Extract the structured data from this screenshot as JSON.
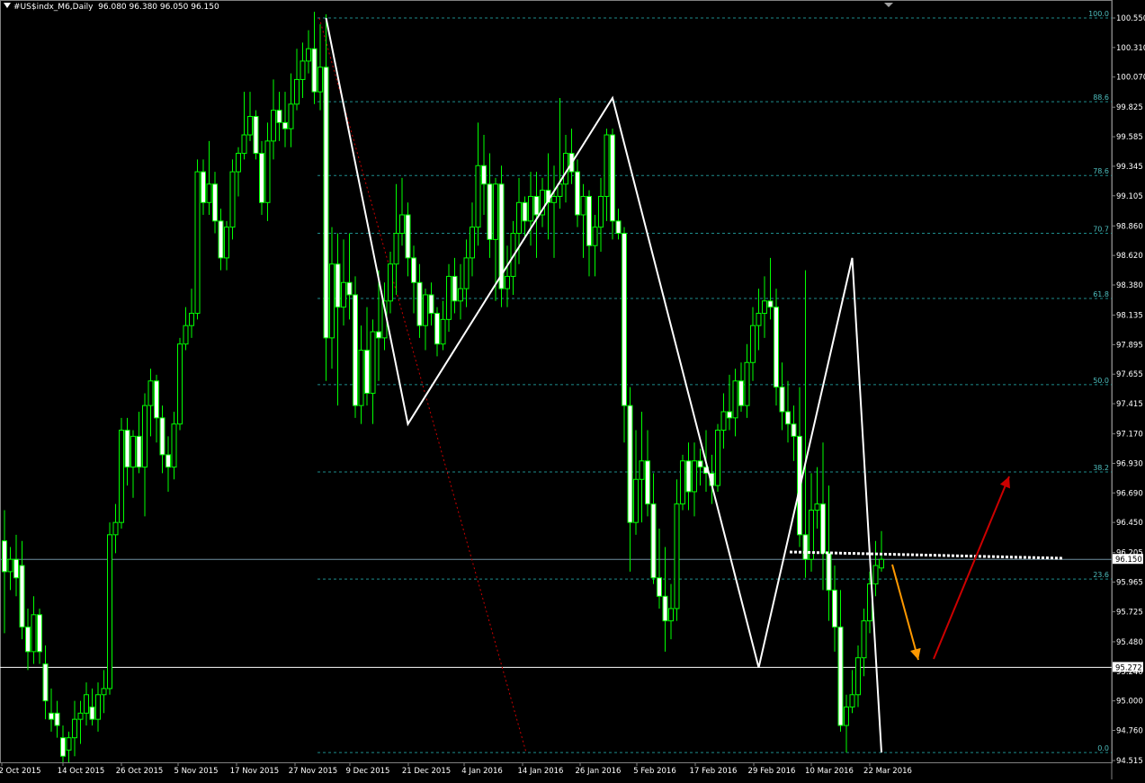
{
  "header": {
    "symbol_title": "#US$indx_M6,Daily",
    "ohlc": "96.080 96.380 96.050 96.150"
  },
  "colors": {
    "background": "#000000",
    "candle": "#00ff00",
    "fib_line": "#1e8c8c",
    "fib_text": "#4fbfbf",
    "zigzag": "#ffffff",
    "axis_text": "#ffffff",
    "trend_dotted": "#cc0000",
    "arrow_down": "#ff9900",
    "arrow_up": "#cc0000",
    "price_line": "#6f8fa0"
  },
  "chart_data": {
    "type": "candlestick",
    "title": "#US$indx_M6,Daily",
    "y_range": [
      94.515,
      100.66
    ],
    "y_tick_labels": [
      "100.550",
      "100.310",
      "100.070",
      "99.825",
      "99.585",
      "99.345",
      "99.105",
      "98.860",
      "98.620",
      "98.380",
      "98.135",
      "97.895",
      "97.655",
      "97.415",
      "97.170",
      "96.930",
      "96.690",
      "96.450",
      "96.205",
      "95.965",
      "95.725",
      "95.480",
      "95.240",
      "95.000",
      "94.760",
      "94.515"
    ],
    "x_tick_labels": [
      "2 Oct 2015",
      "14 Oct 2015",
      "26 Oct 2015",
      "5 Nov 2015",
      "17 Nov 2015",
      "27 Nov 2015",
      "9 Dec 2015",
      "21 Dec 2015",
      "4 Jan 2016",
      "14 Jan 2016",
      "26 Jan 2016",
      "5 Feb 2016",
      "17 Feb 2016",
      "29 Feb 2016",
      "10 Mar 2016",
      "22 Mar 2016"
    ],
    "current_price": "96.150",
    "horizontal_level": "95.272",
    "fibonacci_levels": [
      {
        "label": "100.0",
        "price": 100.55
      },
      {
        "label": "88.6",
        "price": 99.87
      },
      {
        "label": "78.6",
        "price": 99.27
      },
      {
        "label": "70.7",
        "price": 98.8
      },
      {
        "label": "61.8",
        "price": 98.27
      },
      {
        "label": "50.0",
        "price": 97.57
      },
      {
        "label": "38.2",
        "price": 96.86
      },
      {
        "label": "23.6",
        "price": 95.99
      },
      {
        "label": "0.0",
        "price": 94.58
      }
    ],
    "zigzag": [
      {
        "date": "27 Nov 2015",
        "price": 100.55
      },
      {
        "date": "9 Dec 2015",
        "price": 97.25
      },
      {
        "date": "14 Jan 2016",
        "price": 99.9
      },
      {
        "date": "5 Feb 2016",
        "price": 95.27
      },
      {
        "date": "29 Feb 2016",
        "price": 98.6
      },
      {
        "date": "14 Mar 2016",
        "price": 94.58
      }
    ],
    "candles": [
      {
        "o": 96.3,
        "h": 96.55,
        "l": 95.55,
        "c": 96.05
      },
      {
        "o": 96.05,
        "h": 96.25,
        "l": 95.9,
        "c": 96.15
      },
      {
        "o": 96.15,
        "h": 96.35,
        "l": 95.85,
        "c": 96.0
      },
      {
        "o": 96.1,
        "h": 96.3,
        "l": 95.5,
        "c": 95.6
      },
      {
        "o": 95.6,
        "h": 95.75,
        "l": 95.25,
        "c": 95.4
      },
      {
        "o": 95.4,
        "h": 95.85,
        "l": 95.3,
        "c": 95.7
      },
      {
        "o": 95.7,
        "h": 95.75,
        "l": 95.3,
        "c": 95.4
      },
      {
        "o": 95.3,
        "h": 95.45,
        "l": 94.85,
        "c": 95.0
      },
      {
        "o": 94.9,
        "h": 95.1,
        "l": 94.75,
        "c": 94.85
      },
      {
        "o": 94.9,
        "h": 95.0,
        "l": 94.7,
        "c": 94.8
      },
      {
        "o": 94.7,
        "h": 94.8,
        "l": 94.5,
        "c": 94.55
      },
      {
        "o": 94.6,
        "h": 94.75,
        "l": 94.5,
        "c": 94.7
      },
      {
        "o": 94.7,
        "h": 95.0,
        "l": 94.55,
        "c": 94.85
      },
      {
        "o": 94.85,
        "h": 95.0,
        "l": 94.65,
        "c": 94.9
      },
      {
        "o": 94.9,
        "h": 95.15,
        "l": 94.8,
        "c": 95.05
      },
      {
        "o": 94.95,
        "h": 95.1,
        "l": 94.8,
        "c": 94.85
      },
      {
        "o": 94.85,
        "h": 95.15,
        "l": 94.75,
        "c": 95.05
      },
      {
        "o": 95.05,
        "h": 95.25,
        "l": 94.9,
        "c": 95.1
      },
      {
        "o": 95.1,
        "h": 96.45,
        "l": 95.05,
        "c": 96.35
      },
      {
        "o": 96.35,
        "h": 96.6,
        "l": 96.2,
        "c": 96.45
      },
      {
        "o": 96.45,
        "h": 97.3,
        "l": 96.4,
        "c": 97.2
      },
      {
        "o": 97.2,
        "h": 97.3,
        "l": 96.75,
        "c": 96.9
      },
      {
        "o": 96.9,
        "h": 97.2,
        "l": 96.65,
        "c": 97.15
      },
      {
        "o": 97.15,
        "h": 97.35,
        "l": 96.85,
        "c": 96.9
      },
      {
        "o": 96.9,
        "h": 97.5,
        "l": 96.5,
        "c": 97.4
      },
      {
        "o": 97.4,
        "h": 97.7,
        "l": 97.15,
        "c": 97.6
      },
      {
        "o": 97.6,
        "h": 97.65,
        "l": 97.1,
        "c": 97.3
      },
      {
        "o": 97.3,
        "h": 97.4,
        "l": 96.85,
        "c": 97.0
      },
      {
        "o": 97.0,
        "h": 97.15,
        "l": 96.7,
        "c": 96.9
      },
      {
        "o": 96.9,
        "h": 97.35,
        "l": 96.8,
        "c": 97.25
      },
      {
        "o": 97.25,
        "h": 97.95,
        "l": 97.2,
        "c": 97.9
      },
      {
        "o": 97.9,
        "h": 98.2,
        "l": 97.85,
        "c": 98.05
      },
      {
        "o": 98.05,
        "h": 98.35,
        "l": 97.95,
        "c": 98.15
      },
      {
        "o": 98.15,
        "h": 99.4,
        "l": 98.1,
        "c": 99.3
      },
      {
        "o": 99.3,
        "h": 99.4,
        "l": 98.95,
        "c": 99.05
      },
      {
        "o": 99.05,
        "h": 99.55,
        "l": 98.95,
        "c": 99.2
      },
      {
        "o": 99.2,
        "h": 99.3,
        "l": 98.8,
        "c": 98.9
      },
      {
        "o": 98.9,
        "h": 99.0,
        "l": 98.5,
        "c": 98.6
      },
      {
        "o": 98.6,
        "h": 98.9,
        "l": 98.5,
        "c": 98.85
      },
      {
        "o": 98.85,
        "h": 99.4,
        "l": 98.75,
        "c": 99.3
      },
      {
        "o": 99.3,
        "h": 99.5,
        "l": 99.1,
        "c": 99.45
      },
      {
        "o": 99.45,
        "h": 99.95,
        "l": 99.4,
        "c": 99.6
      },
      {
        "o": 99.6,
        "h": 99.95,
        "l": 99.55,
        "c": 99.75
      },
      {
        "o": 99.75,
        "h": 99.8,
        "l": 99.4,
        "c": 99.45
      },
      {
        "o": 99.45,
        "h": 99.55,
        "l": 98.95,
        "c": 99.05
      },
      {
        "o": 99.05,
        "h": 99.7,
        "l": 98.9,
        "c": 99.55
      },
      {
        "o": 99.55,
        "h": 100.05,
        "l": 99.4,
        "c": 99.8
      },
      {
        "o": 99.8,
        "h": 99.95,
        "l": 99.55,
        "c": 99.7
      },
      {
        "o": 99.7,
        "h": 99.95,
        "l": 99.5,
        "c": 99.65
      },
      {
        "o": 99.65,
        "h": 100.1,
        "l": 99.5,
        "c": 99.85
      },
      {
        "o": 99.85,
        "h": 100.3,
        "l": 99.8,
        "c": 100.05
      },
      {
        "o": 100.05,
        "h": 100.35,
        "l": 99.9,
        "c": 100.2
      },
      {
        "o": 100.2,
        "h": 100.45,
        "l": 100.1,
        "c": 100.3
      },
      {
        "o": 100.3,
        "h": 100.6,
        "l": 99.85,
        "c": 99.95
      },
      {
        "o": 99.95,
        "h": 100.5,
        "l": 99.8,
        "c": 100.15
      },
      {
        "o": 100.15,
        "h": 100.58,
        "l": 97.6,
        "c": 97.95
      },
      {
        "o": 97.95,
        "h": 98.85,
        "l": 97.7,
        "c": 98.55
      },
      {
        "o": 98.55,
        "h": 98.8,
        "l": 97.4,
        "c": 98.2
      },
      {
        "o": 98.2,
        "h": 98.75,
        "l": 98.05,
        "c": 98.4
      },
      {
        "o": 98.4,
        "h": 98.8,
        "l": 98.1,
        "c": 98.3
      },
      {
        "o": 98.3,
        "h": 98.45,
        "l": 97.3,
        "c": 97.4
      },
      {
        "o": 97.4,
        "h": 98.05,
        "l": 97.25,
        "c": 97.85
      },
      {
        "o": 97.85,
        "h": 98.2,
        "l": 97.4,
        "c": 97.5
      },
      {
        "o": 97.5,
        "h": 98.1,
        "l": 97.25,
        "c": 98.0
      },
      {
        "o": 98.0,
        "h": 98.5,
        "l": 97.6,
        "c": 97.95
      },
      {
        "o": 97.95,
        "h": 98.4,
        "l": 97.85,
        "c": 98.25
      },
      {
        "o": 98.25,
        "h": 98.65,
        "l": 98.15,
        "c": 98.55
      },
      {
        "o": 98.55,
        "h": 99.2,
        "l": 98.3,
        "c": 98.8
      },
      {
        "o": 98.8,
        "h": 99.25,
        "l": 98.7,
        "c": 98.95
      },
      {
        "o": 98.95,
        "h": 99.05,
        "l": 98.45,
        "c": 98.6
      },
      {
        "o": 98.6,
        "h": 98.7,
        "l": 98.15,
        "c": 98.4
      },
      {
        "o": 98.4,
        "h": 98.55,
        "l": 97.95,
        "c": 98.05
      },
      {
        "o": 98.05,
        "h": 98.35,
        "l": 97.85,
        "c": 98.3
      },
      {
        "o": 98.3,
        "h": 98.4,
        "l": 98.05,
        "c": 98.15
      },
      {
        "o": 98.15,
        "h": 98.2,
        "l": 97.8,
        "c": 97.9
      },
      {
        "o": 97.9,
        "h": 98.25,
        "l": 97.85,
        "c": 98.1
      },
      {
        "o": 98.1,
        "h": 98.55,
        "l": 98.0,
        "c": 98.45
      },
      {
        "o": 98.45,
        "h": 98.6,
        "l": 98.15,
        "c": 98.25
      },
      {
        "o": 98.25,
        "h": 98.55,
        "l": 98.1,
        "c": 98.35
      },
      {
        "o": 98.35,
        "h": 98.75,
        "l": 98.2,
        "c": 98.6
      },
      {
        "o": 98.6,
        "h": 99.05,
        "l": 98.45,
        "c": 98.85
      },
      {
        "o": 98.85,
        "h": 99.7,
        "l": 98.7,
        "c": 99.35
      },
      {
        "o": 99.35,
        "h": 99.6,
        "l": 98.95,
        "c": 99.2
      },
      {
        "o": 99.2,
        "h": 99.45,
        "l": 98.6,
        "c": 98.75
      },
      {
        "o": 98.75,
        "h": 99.25,
        "l": 98.25,
        "c": 99.2
      },
      {
        "o": 99.2,
        "h": 99.35,
        "l": 98.2,
        "c": 98.35
      },
      {
        "o": 98.35,
        "h": 98.7,
        "l": 98.2,
        "c": 98.45
      },
      {
        "o": 98.45,
        "h": 98.9,
        "l": 98.3,
        "c": 98.8
      },
      {
        "o": 98.8,
        "h": 99.25,
        "l": 98.55,
        "c": 99.05
      },
      {
        "o": 99.05,
        "h": 99.1,
        "l": 98.75,
        "c": 98.9
      },
      {
        "o": 98.9,
        "h": 99.3,
        "l": 98.7,
        "c": 99.1
      },
      {
        "o": 99.1,
        "h": 99.3,
        "l": 98.6,
        "c": 98.95
      },
      {
        "o": 98.95,
        "h": 99.25,
        "l": 98.85,
        "c": 99.15
      },
      {
        "o": 99.15,
        "h": 99.45,
        "l": 98.75,
        "c": 99.05
      },
      {
        "o": 99.05,
        "h": 99.35,
        "l": 98.6,
        "c": 99.1
      },
      {
        "o": 99.1,
        "h": 99.9,
        "l": 99.0,
        "c": 99.2
      },
      {
        "o": 99.2,
        "h": 99.6,
        "l": 99.05,
        "c": 99.45
      },
      {
        "o": 99.45,
        "h": 99.65,
        "l": 99.2,
        "c": 99.3
      },
      {
        "o": 99.3,
        "h": 99.4,
        "l": 98.85,
        "c": 98.95
      },
      {
        "o": 98.95,
        "h": 99.2,
        "l": 98.6,
        "c": 99.1
      },
      {
        "o": 99.1,
        "h": 99.15,
        "l": 98.45,
        "c": 98.7
      },
      {
        "o": 98.7,
        "h": 98.95,
        "l": 98.45,
        "c": 98.85
      },
      {
        "o": 98.85,
        "h": 99.25,
        "l": 98.65,
        "c": 99.1
      },
      {
        "o": 99.1,
        "h": 99.65,
        "l": 98.9,
        "c": 99.6
      },
      {
        "o": 99.6,
        "h": 99.65,
        "l": 98.75,
        "c": 98.9
      },
      {
        "o": 98.9,
        "h": 99.0,
        "l": 98.75,
        "c": 98.8
      },
      {
        "o": 98.8,
        "h": 98.85,
        "l": 97.1,
        "c": 97.4
      },
      {
        "o": 97.4,
        "h": 97.55,
        "l": 96.05,
        "c": 96.45
      },
      {
        "o": 96.45,
        "h": 97.2,
        "l": 96.35,
        "c": 96.8
      },
      {
        "o": 96.8,
        "h": 97.35,
        "l": 96.45,
        "c": 96.95
      },
      {
        "o": 96.95,
        "h": 97.2,
        "l": 96.5,
        "c": 96.6
      },
      {
        "o": 96.6,
        "h": 96.85,
        "l": 95.95,
        "c": 96.0
      },
      {
        "o": 96.0,
        "h": 96.4,
        "l": 95.75,
        "c": 95.85
      },
      {
        "o": 95.85,
        "h": 96.25,
        "l": 95.4,
        "c": 95.65
      },
      {
        "o": 95.65,
        "h": 95.95,
        "l": 95.5,
        "c": 95.75
      },
      {
        "o": 95.75,
        "h": 96.8,
        "l": 95.65,
        "c": 96.6
      },
      {
        "o": 96.6,
        "h": 97.0,
        "l": 96.55,
        "c": 96.95
      },
      {
        "o": 96.95,
        "h": 97.1,
        "l": 96.55,
        "c": 96.7
      },
      {
        "o": 96.7,
        "h": 97.1,
        "l": 96.5,
        "c": 96.95
      },
      {
        "o": 96.95,
        "h": 97.05,
        "l": 96.75,
        "c": 96.9
      },
      {
        "o": 96.9,
        "h": 97.2,
        "l": 96.7,
        "c": 96.85
      },
      {
        "o": 96.85,
        "h": 97.0,
        "l": 96.6,
        "c": 96.75
      },
      {
        "o": 96.75,
        "h": 97.25,
        "l": 96.7,
        "c": 97.2
      },
      {
        "o": 97.2,
        "h": 97.5,
        "l": 97.05,
        "c": 97.35
      },
      {
        "o": 97.35,
        "h": 97.65,
        "l": 97.2,
        "c": 97.3
      },
      {
        "o": 97.3,
        "h": 97.7,
        "l": 97.15,
        "c": 97.6
      },
      {
        "o": 97.6,
        "h": 97.75,
        "l": 97.35,
        "c": 97.4
      },
      {
        "o": 97.4,
        "h": 97.9,
        "l": 97.3,
        "c": 97.75
      },
      {
        "o": 97.75,
        "h": 98.2,
        "l": 97.6,
        "c": 98.05
      },
      {
        "o": 98.05,
        "h": 98.35,
        "l": 97.85,
        "c": 98.15
      },
      {
        "o": 98.15,
        "h": 98.45,
        "l": 97.95,
        "c": 98.25
      },
      {
        "o": 98.25,
        "h": 98.6,
        "l": 98.1,
        "c": 98.2
      },
      {
        "o": 98.2,
        "h": 98.35,
        "l": 97.4,
        "c": 97.55
      },
      {
        "o": 97.55,
        "h": 97.75,
        "l": 97.2,
        "c": 97.35
      },
      {
        "o": 97.35,
        "h": 97.6,
        "l": 97.1,
        "c": 97.25
      },
      {
        "o": 97.25,
        "h": 97.4,
        "l": 96.95,
        "c": 97.15
      },
      {
        "o": 97.15,
        "h": 97.55,
        "l": 96.25,
        "c": 96.35
      },
      {
        "o": 96.35,
        "h": 98.5,
        "l": 96.0,
        "c": 96.15
      },
      {
        "o": 96.15,
        "h": 96.85,
        "l": 96.05,
        "c": 96.55
      },
      {
        "o": 96.55,
        "h": 96.9,
        "l": 96.4,
        "c": 96.6
      },
      {
        "o": 96.6,
        "h": 97.1,
        "l": 95.9,
        "c": 96.2
      },
      {
        "o": 96.2,
        "h": 96.75,
        "l": 95.65,
        "c": 95.9
      },
      {
        "o": 95.9,
        "h": 96.1,
        "l": 95.4,
        "c": 95.6
      },
      {
        "o": 95.6,
        "h": 95.9,
        "l": 94.75,
        "c": 94.8
      },
      {
        "o": 94.8,
        "h": 95.05,
        "l": 94.58,
        "c": 94.95
      },
      {
        "o": 94.95,
        "h": 95.25,
        "l": 94.9,
        "c": 95.05
      },
      {
        "o": 95.05,
        "h": 95.45,
        "l": 94.95,
        "c": 95.35
      },
      {
        "o": 95.35,
        "h": 95.75,
        "l": 95.2,
        "c": 95.65
      },
      {
        "o": 95.65,
        "h": 96.05,
        "l": 95.55,
        "c": 95.95
      },
      {
        "o": 95.95,
        "h": 96.3,
        "l": 95.85,
        "c": 96.1
      },
      {
        "o": 96.08,
        "h": 96.38,
        "l": 96.05,
        "c": 96.15
      }
    ]
  }
}
